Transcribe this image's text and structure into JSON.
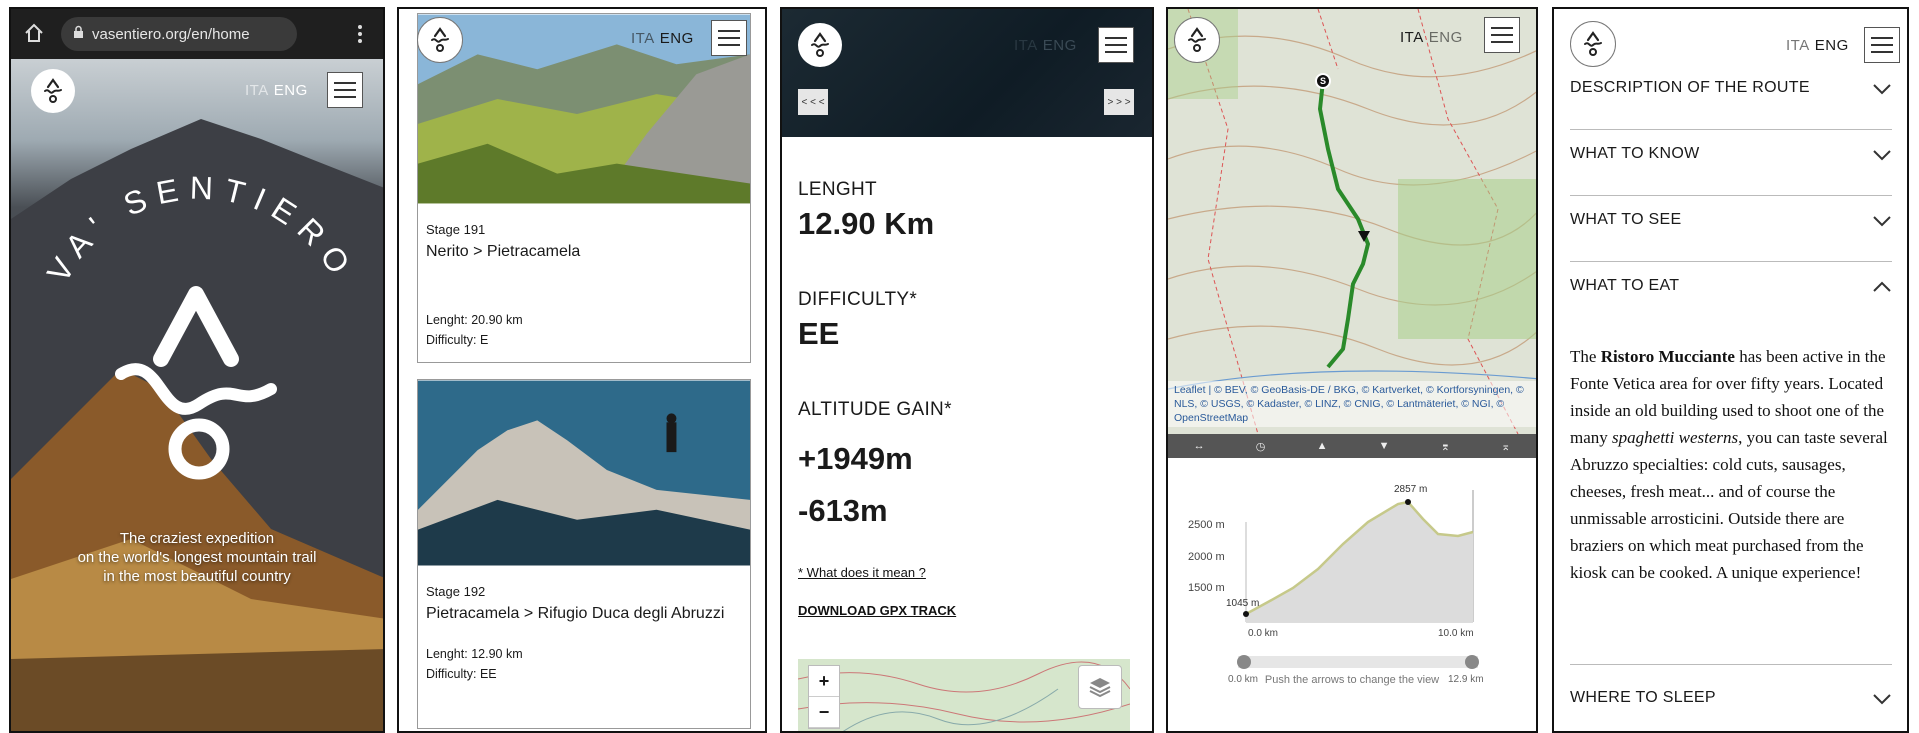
{
  "panel1": {
    "url": "vasentiero.org/en/home",
    "lang_ita": "ITA",
    "lang_eng": "ENG",
    "brand_arc": "VA' SENTIERO",
    "tagline_1": "The craziest expedition",
    "tagline_2": "on the world's longest mountain trail",
    "tagline_3": "in the most beautiful country"
  },
  "panel2": {
    "lang_ita": "ITA",
    "lang_eng": "ENG",
    "cards": [
      {
        "stage": "Stage 191",
        "route": "Nerito > Pietracamela",
        "length_label": "Lenght:",
        "length": "20.90 km",
        "difficulty_label": "Difficulty:",
        "difficulty": "E"
      },
      {
        "stage": "Stage 192",
        "route": "Pietracamela > Rifugio Duca degli Abruzzi",
        "length_label": "Lenght:",
        "length": "12.90 km",
        "difficulty_label": "Difficulty:",
        "difficulty": "EE"
      }
    ]
  },
  "panel3": {
    "lang_ita": "ITA",
    "lang_eng": "ENG",
    "prev": "< < <",
    "next": "> > >",
    "length_label": "LENGHT",
    "length_value": "12.90 Km",
    "difficulty_label": "DIFFICULTY*",
    "difficulty_value": "EE",
    "altitude_label": "ALTITUDE GAIN*",
    "altitude_up": "+1949m",
    "altitude_down": "-613m",
    "meaning_link": "* What does it mean ?",
    "gpx_link": "DOWNLOAD GPX TRACK",
    "zoom_in": "+",
    "zoom_out": "−"
  },
  "panel4": {
    "lang_ita": "ITA",
    "lang_eng": "ENG",
    "start_marker": "S",
    "attribution": "Leaflet | © BEV, © GeoBasis-DE / BKG, © Kartverket, © Kortforsyningen, © NLS, © USGS, © Kadaster, © LINZ, © CNIG, © Lantmäteriet, © NGI, © OpenStreetMap",
    "toolbar": [
      "↔",
      "◷",
      "▲",
      "▼",
      "⌆",
      "⌅"
    ],
    "profile": {
      "y_ticks": [
        "2500 m",
        "2000 m",
        "1500 m"
      ],
      "peak_label": "2857 m",
      "start_label": "1045 m",
      "x_start": "0.0 km",
      "x_mid": "10.0 km",
      "slider_start": "0.0 km",
      "slider_end": "12.9 km",
      "hint": "Push the arrows to change the view"
    }
  },
  "panel5": {
    "lang_ita": "ITA",
    "lang_eng": "ENG",
    "sections": [
      "DESCRIPTION OF THE ROUTE",
      "WHAT TO KNOW",
      "WHAT TO SEE",
      "WHAT TO EAT",
      "WHERE TO SLEEP"
    ],
    "eat": {
      "p1": "The ",
      "bold": "Ristoro Mucciante",
      "p2": " has been active in the Fonte Vetica area for over fifty years. Located inside an old building used to shoot one of the many ",
      "italic": "spaghetti westerns",
      "p3": ", you can taste several Abruzzo specialties: cold cuts, sausages, cheeses, fresh meat... and of course the unmissable arrosticini. Outside there are braziers on which meat purchased from the kiosk can be cooked. A unique experience!"
    }
  }
}
